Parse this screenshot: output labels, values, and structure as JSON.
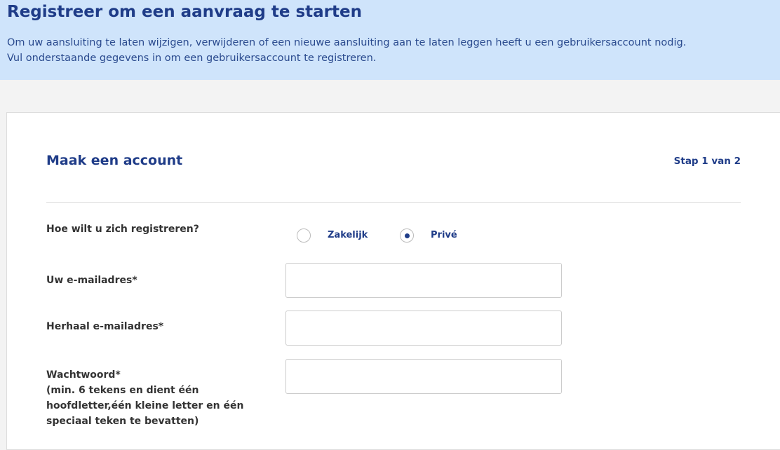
{
  "banner": {
    "title": "Registreer om een aanvraag te starten",
    "line1": "Om uw aansluiting te laten wijzigen, verwijderen of een nieuwe aansluiting aan te laten leggen heeft u een gebruikersaccount nodig.",
    "line2": "Vul onderstaande gegevens in om een gebruikersaccount te registreren."
  },
  "form": {
    "title": "Maak een account",
    "step": "Stap 1 van 2",
    "register_question": "Hoe wilt u zich registreren?",
    "options": [
      {
        "label": "Zakelijk",
        "selected": false
      },
      {
        "label": "Privé",
        "selected": true
      }
    ],
    "email_label": "Uw e-mailadres*",
    "email_value": "",
    "repeat_email_label": "Herhaal e-mailadres*",
    "repeat_email_value": "",
    "password_label": "Wachtwoord*",
    "password_help": [
      "(min. 6 tekens en dient één",
      "hoofdletter,één kleine letter en één",
      "speciaal teken te bevatten)"
    ],
    "password_value": ""
  },
  "colors": {
    "banner_bg": "#cfe4fb",
    "accent": "#1f3c88"
  }
}
